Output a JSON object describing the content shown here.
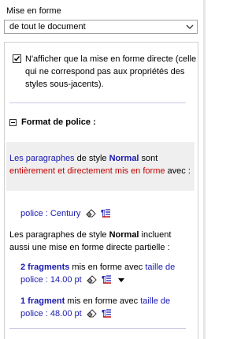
{
  "header": {
    "label": "Mise en forme"
  },
  "scope_select": {
    "value": "de tout le document"
  },
  "option": {
    "checked": true,
    "text": "N'afficher que la mise en forme directe (celle qui ne correspond pas aux propriétés des styles sous-jacents)."
  },
  "section": {
    "title": "Format de police :"
  },
  "block1": {
    "link_paragraphs": "Les paragraphes",
    "text_style": " de style ",
    "style_name": "Normal",
    "text_are": " sont ",
    "red_text": "entièrement et directement mis en forme",
    "text_with": " avec :",
    "font_link": "police : Century"
  },
  "block2": {
    "text_intro": "Les paragraphes de style ",
    "style_name": "Normal",
    "text_rest": " incluent aussi une  mise en forme directe partielle :",
    "item1": {
      "count_link": "2 fragments",
      "text": " mis en forme avec ",
      "prop_link": "taille de police : 14.00 pt"
    },
    "item2": {
      "count_link": "1 fragment",
      "text": " mis en forme avec ",
      "prop_link": "taille de police : 48.00 pt"
    }
  },
  "colors": {
    "link": "#1a1ab0",
    "emphasis": "#c00000",
    "separator": "#c8c8e0"
  },
  "icons": [
    "eraser-icon",
    "select-text-icon",
    "dropdown-arrow-icon"
  ]
}
